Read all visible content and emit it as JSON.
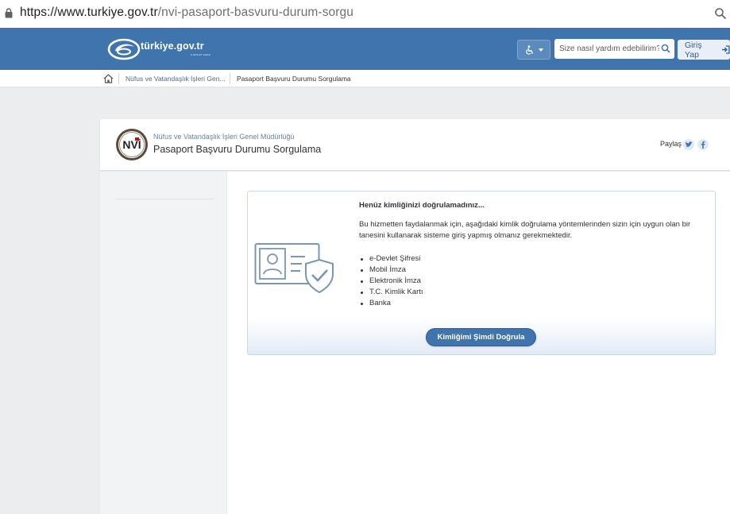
{
  "browser": {
    "url_host": "https://www.turkiye.gov.tr",
    "url_path": "/nvi-pasaport-basvuru-durum-sorgu"
  },
  "header": {
    "logo_text": "türkiye.gov.tr",
    "logo_subtext": "E-DEVLET KAPISI",
    "search_placeholder": "Size nasıl yardım edebilirim?",
    "login_label": "Giriş Yap",
    "brand_color": "#3f74ad"
  },
  "breadcrumb": {
    "items": [
      "Nüfus ve Vatandaşlık İşleri Gen...",
      "Pasaport Başvuru Durumu Sorgulama"
    ]
  },
  "service": {
    "org_name": "Nüfus ve Vatandaşlık İşleri Genel Müdürlüğü",
    "title": "Pasaport Başvuru Durumu Sorgulama",
    "share_label": "Paylaş"
  },
  "panel": {
    "title": "Henüz kimliğinizi doğrulamadınız...",
    "description": "Bu hizmetten faydalanmak için, aşağıdaki kimlik doğrulama yöntemlerinden sizin için uygun olan bir tanesini kullanarak sisteme giriş yapmış olmanız gerekmektedir.",
    "methods": [
      "e-Devlet Şifresi",
      "Mobil İmza",
      "Elektronik İmza",
      "T.C. Kimlik Kartı",
      "Banka"
    ],
    "button_label": "Kimliğimi Şimdi Doğrula"
  }
}
